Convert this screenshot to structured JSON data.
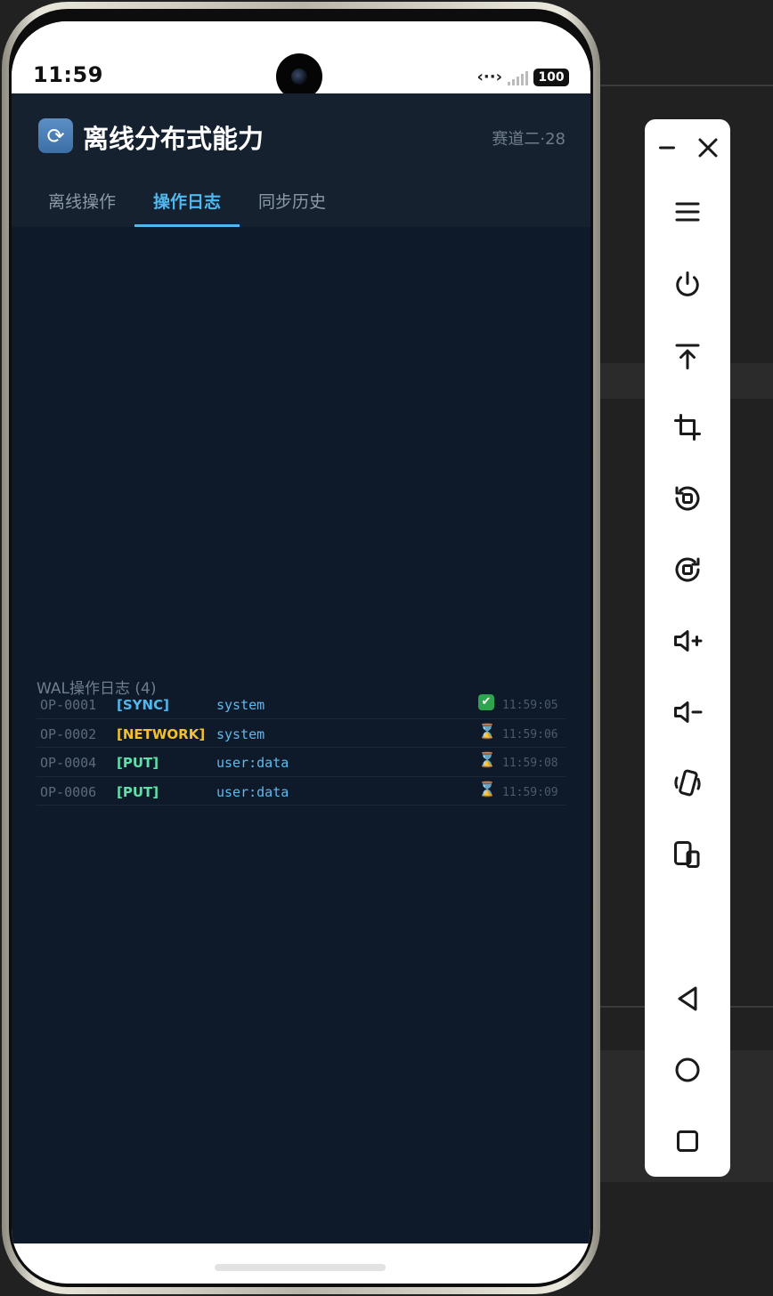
{
  "status_bar": {
    "time": "11:59",
    "battery": "100"
  },
  "app": {
    "title": "离线分布式能力",
    "badge": "赛道二·28",
    "logo_icon": "sync-icon"
  },
  "tabs": [
    {
      "label": "离线操作",
      "active": false
    },
    {
      "label": "操作日志",
      "active": true
    },
    {
      "label": "同步历史",
      "active": false
    }
  ],
  "log": {
    "title": "WAL操作日志 (4)",
    "rows": [
      {
        "id": "OP-0001",
        "type": "[SYNC]",
        "type_color": "#4fb8ef",
        "target": "system",
        "status": "done",
        "time": "11:59:05"
      },
      {
        "id": "OP-0002",
        "type": "[NETWORK]",
        "type_color": "#f2c12e",
        "target": "system",
        "status": "pending",
        "time": "11:59:06"
      },
      {
        "id": "OP-0004",
        "type": "[PUT]",
        "type_color": "#5fe0a8",
        "target": "user:data",
        "status": "pending",
        "time": "11:59:08"
      },
      {
        "id": "OP-0006",
        "type": "[PUT]",
        "type_color": "#5fe0a8",
        "target": "user:data",
        "status": "pending",
        "time": "11:59:09"
      }
    ]
  },
  "toolbar": {
    "buttons": [
      "minimize-icon",
      "close-icon",
      "menu-icon",
      "power-icon",
      "pin-top-icon",
      "crop-icon",
      "rotate-left-icon",
      "rotate-right-icon",
      "volume-up-icon",
      "volume-down-icon",
      "shake-icon",
      "multi-device-icon",
      "back-icon",
      "home-icon",
      "recent-apps-icon"
    ]
  }
}
